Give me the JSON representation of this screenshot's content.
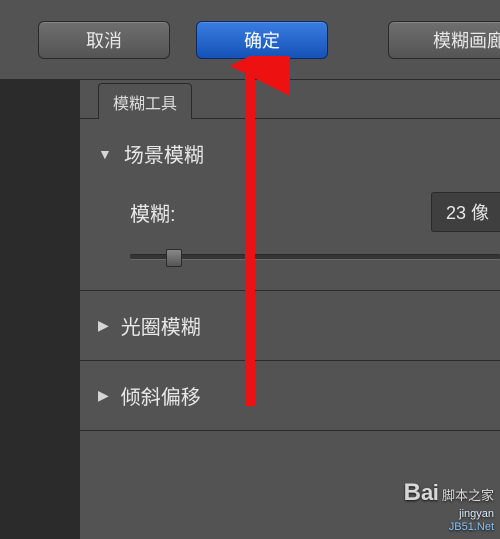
{
  "toolbar": {
    "cancel_label": "取消",
    "ok_label": "确定",
    "gallery_label": "模糊画廊"
  },
  "panel": {
    "tab_label": "模糊工具",
    "sections": {
      "field_blur": {
        "title": "场景模糊",
        "open": true,
        "param_label": "模糊:",
        "param_value": "23 像"
      },
      "iris_blur": {
        "title": "光圈模糊",
        "open": false
      },
      "tilt_shift": {
        "title": "倾斜偏移",
        "open": false
      }
    }
  },
  "watermark": {
    "line1a": "B",
    "line1b": "ai",
    "line1c": "脚本之家",
    "line2": "jingyan",
    "line3": "JB51.Net"
  }
}
